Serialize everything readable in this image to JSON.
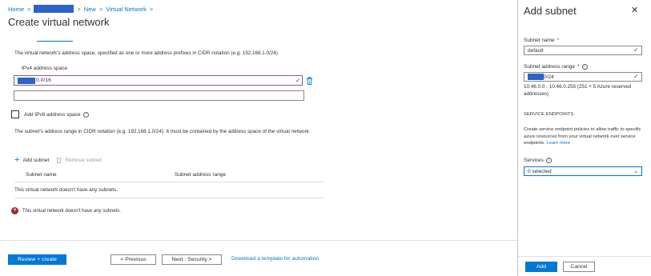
{
  "breadcrumb": {
    "home": "Home",
    "new": "New",
    "current": "Virtual Network"
  },
  "page_title": "Create virtual network",
  "address_space": {
    "description": "The virtual network's address space, specified as one or more address prefixes in CIDR notation (e.g. 192.168.1.0/24).",
    "label": "IPv4 address space",
    "value_suffix": "0.0/16",
    "empty_value": ""
  },
  "ipv6": {
    "label": "Add IPv6 address space"
  },
  "subnet_hint": "The subnet's address range in CIDR notation (e.g. 192.168.1.0/24). It must be contained by the address space of the virtual network.",
  "subnet_toolbar": {
    "add": "Add subnet",
    "remove": "Remove subnet"
  },
  "subnet_table": {
    "columns": [
      "Subnet name",
      "Subnet address range"
    ],
    "empty": "This virtual network doesn't have any subnets."
  },
  "error_message": "This virtual network doesn't have any subnets.",
  "footer": {
    "review": "Review + create",
    "previous": "< Previous",
    "next": "Next : Security >",
    "download": "Download a template for automation"
  },
  "panel": {
    "title": "Add subnet",
    "subnet_name_label": "Subnet name",
    "subnet_name_value": "default",
    "range_label": "Subnet address range",
    "range_value_suffix": "0/24",
    "range_hint": "10.46.0.0 - 10.46.0.255 (251 + 5 Azure reserved addresses)",
    "section": "SERVICE ENDPOINTS",
    "endpoints_desc": "Create service endpoint policies to allow traffic to specific azure resources from your virtual network over service endpoints.",
    "learn_more": "Learn more",
    "services_label": "Services",
    "services_value": "0 selected",
    "add": "Add",
    "cancel": "Cancel"
  },
  "colors": {
    "accent": "#0078d4",
    "error": "#a4262c",
    "valid": "#107c10",
    "redaction": "#2b63c7"
  }
}
